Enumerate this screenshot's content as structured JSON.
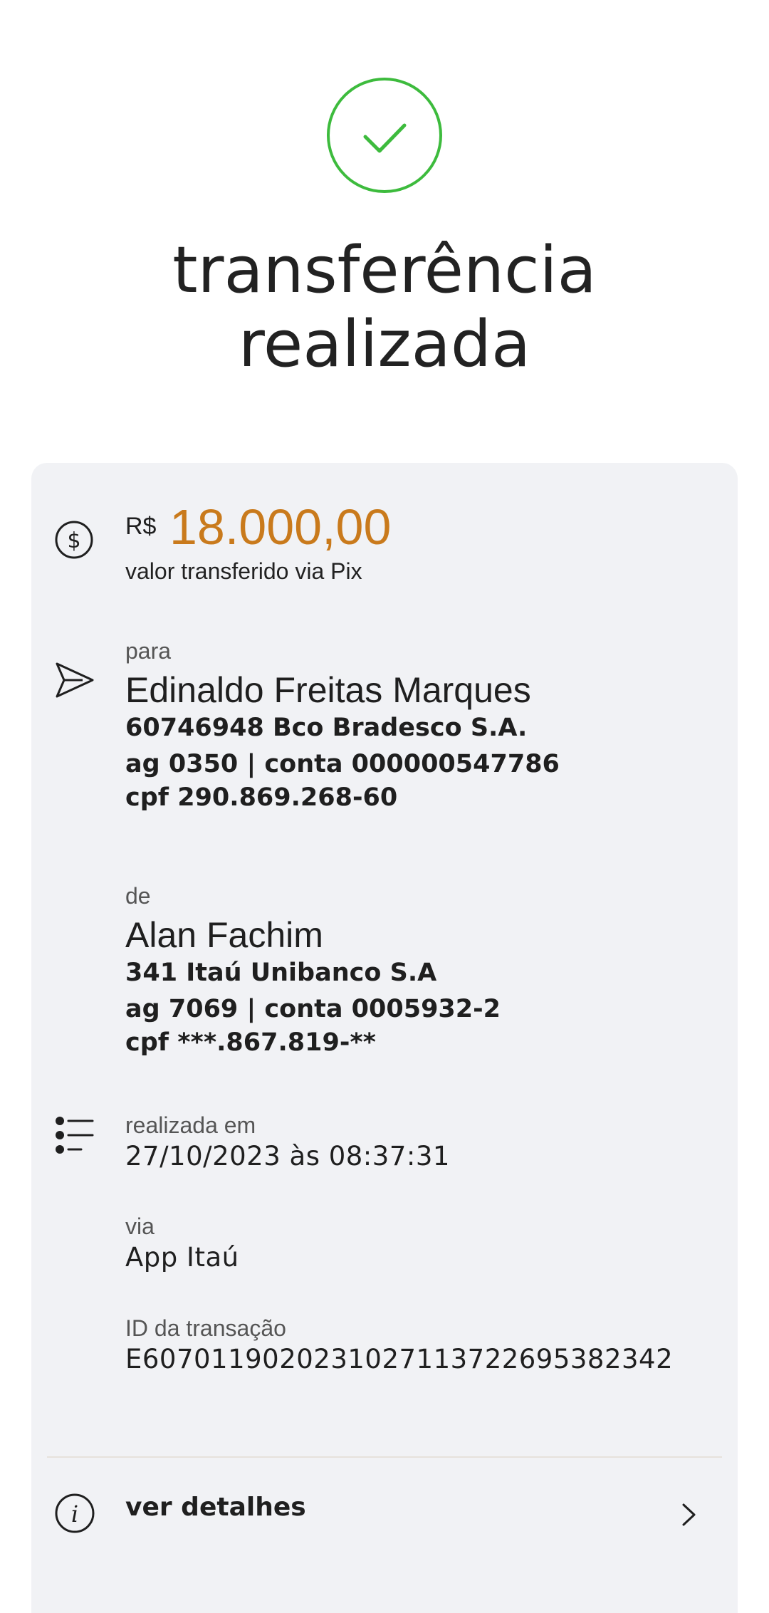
{
  "header": {
    "status_icon": "check-circle-icon",
    "status_color": "#3dbb3d",
    "title_line1": "transferência",
    "title_line2": "realizada"
  },
  "amount": {
    "icon": "dollar-circle-icon",
    "currency": "R$",
    "value": "18.000,00",
    "value_color": "#c97a1c",
    "caption": "valor transferido via Pix"
  },
  "recipient": {
    "icon": "send-icon",
    "label": "para",
    "name": "Edinaldo Freitas Marques",
    "bank": "60746948 Bco Bradesco S.A.",
    "account": "ag 0350 | conta 000000547786",
    "doc": "cpf 290.869.268-60"
  },
  "sender": {
    "label": "de",
    "name": "Alan Fachim",
    "bank": "341 Itaú Unibanco S.A",
    "account": "ag 7069 | conta 0005932-2",
    "doc": "cpf ***.867.819-**"
  },
  "info": {
    "icon": "list-icon",
    "date_label": "realizada em",
    "date_value": "27/10/2023 às 08:37:31",
    "via_label": "via",
    "via_value": "App Itaú",
    "id_label": "ID da transação",
    "id_value": "E60701190202310271137226953823​42"
  },
  "details": {
    "icon": "info-icon",
    "label": "ver detalhes",
    "chevron": "chevron-right-icon"
  }
}
